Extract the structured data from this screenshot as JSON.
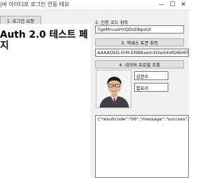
{
  "window": {
    "title": "|버 아이디로 로그인 연동 데모",
    "controls": {
      "minimize": "—",
      "maximize": "☐",
      "close": "✕"
    }
  },
  "step1": {
    "button_label": "1. 로그인 요청"
  },
  "browser": {
    "heading_line1": "Auth 2.0 테스트 페",
    "heading_line2": "지"
  },
  "step2": {
    "label": "2. 인증 코드 취득",
    "code_value": "7geMnuaVmQDsDbpoUI"
  },
  "step3": {
    "button_label": "3. 엑세스 토큰 취득",
    "token_value": "AAAAOkG-0rM-El98bxem3OwS4VID6bMTx5qNRp"
  },
  "step4": {
    "button_label": "4. 네이버 프로필 조회",
    "name_value": "김현수",
    "nickname_value": "험프리"
  },
  "response": {
    "text": "{\"resultcode\":\"00\",\"message\":\"success\",\"response\":{\""
  }
}
